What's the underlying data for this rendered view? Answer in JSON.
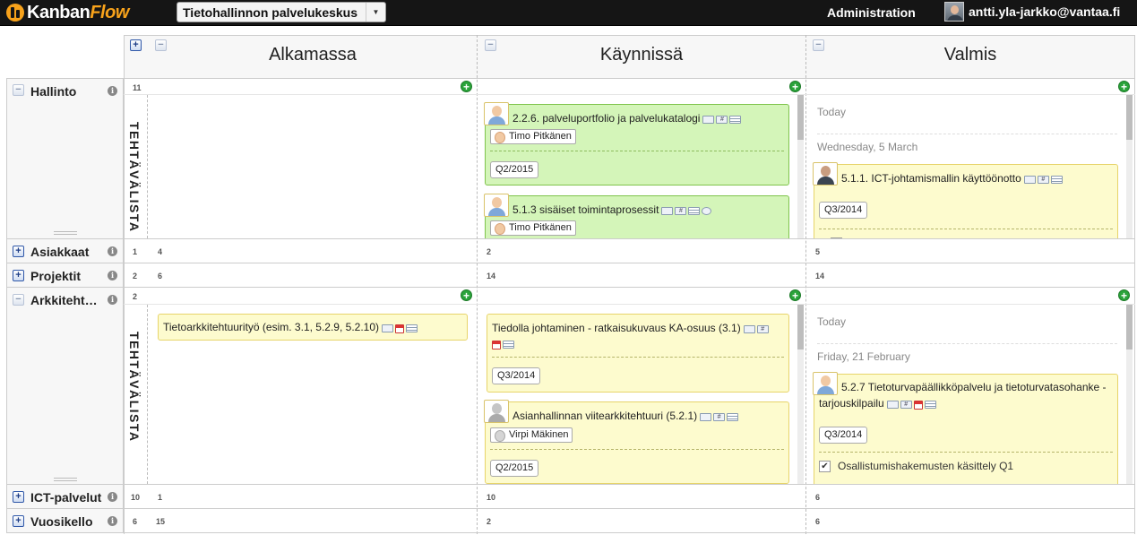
{
  "app": {
    "logo_kanban": "Kanban",
    "logo_flow": "Flow",
    "board_name": "Tietohallinnon palvelukeskus",
    "admin": "Administration",
    "user": "antti.yla-jarkko@vantaa.fi"
  },
  "columns": [
    {
      "title": "Alkamassa"
    },
    {
      "title": "Käynnissä"
    },
    {
      "title": "Valmis"
    }
  ],
  "swimlane_label": "TEHTÄVÄLISTA",
  "rows": [
    {
      "name": "Hallinto",
      "count": "11",
      "expanded": true
    },
    {
      "name": "Asiakkaat",
      "count": "1",
      "col_counts": [
        "4",
        "2",
        "5"
      ]
    },
    {
      "name": "Projektit",
      "count": "2",
      "col_counts": [
        "6",
        "14",
        "14"
      ]
    },
    {
      "name": "Arkkiteht…",
      "count": "2",
      "expanded": true
    },
    {
      "name": "ICT-palvelut",
      "count": "10",
      "col_counts": [
        "1",
        "10",
        "6"
      ]
    },
    {
      "name": "Vuosikello",
      "count": "6",
      "col_counts": [
        "15",
        "2",
        "6"
      ]
    }
  ],
  "hallinto": {
    "kaynnissa": [
      {
        "title": "2.2.6. palveluportfolio ja palvelukatalogi",
        "person": "Timo Pitkänen",
        "tag": "Q2/2015"
      },
      {
        "title": "5.1.3 sisäiset toimintaprosessit",
        "person": "Timo Pitkänen"
      }
    ],
    "valmis": {
      "today": "Today",
      "date": "Wednesday, 5 March",
      "card": {
        "title": "5.1.1. ICT-johtamismallin käyttöönotto",
        "tag": "Q3/2014"
      }
    }
  },
  "arkkitehtuuri": {
    "alkamassa": [
      {
        "title": "Tietoarkkitehtuurityö (esim. 3.1, 5.2.9, 5.2.10)"
      }
    ],
    "kaynnissa": [
      {
        "title": "Tiedolla johtaminen - ratkaisukuvaus KA-osuus (3.1)",
        "tag": "Q3/2014"
      },
      {
        "title": "Asianhallinnan viitearkkitehtuuri (5.2.1)",
        "person": "Virpi Mäkinen",
        "tag": "Q2/2015"
      }
    ],
    "valmis": {
      "today": "Today",
      "date": "Friday, 21 February",
      "card": {
        "title_line1": "5.2.7 Tietoturvapäällikköpalvelu ja tietoturvatasohanke -",
        "title_line2": "tarjouskilpailu",
        "tag": "Q3/2014",
        "subtask": "Osallistumishakemusten käsittely Q1"
      }
    }
  },
  "icons": {
    "plus": "+",
    "minus": "−",
    "info": "i",
    "check": "✔",
    "caret": "▼"
  }
}
